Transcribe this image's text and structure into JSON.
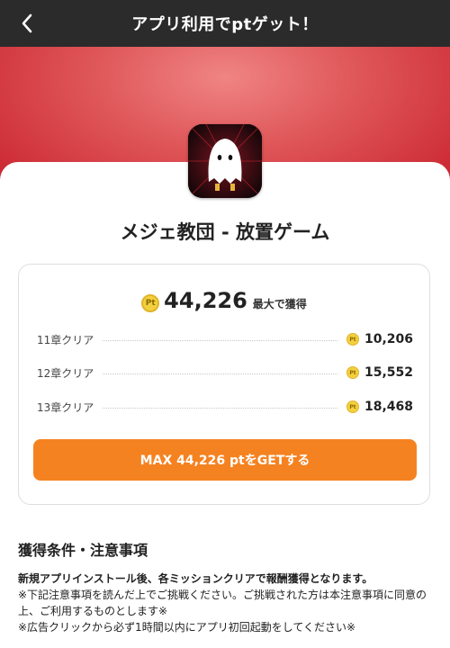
{
  "header": {
    "title": "アプリ利用でptゲット！"
  },
  "app": {
    "name": "メジェ教団 - 放置ゲーム"
  },
  "reward": {
    "coin_label": "Pt",
    "total": "44,226",
    "total_suffix": "最大で獲得",
    "missions": [
      {
        "label": "11章クリア",
        "points": "10,206"
      },
      {
        "label": "12章クリア",
        "points": "15,552"
      },
      {
        "label": "13章クリア",
        "points": "18,468"
      }
    ],
    "button_label": "MAX 44,226 ptをGETする"
  },
  "conditions": {
    "title": "獲得条件・注意事項",
    "lines": [
      "新規アプリインストール後、各ミッションクリアで報酬獲得となります。",
      "※下記注意事項を読んだ上でご挑戦ください。ご挑戦された方は本注意事項に同意の上、ご利用するものとします※",
      "※広告クリックから必ず1時間以内にアプリ初回起動をしてください※"
    ]
  },
  "colors": {
    "header_bg": "#2b2b2b",
    "banner_red": "#c81f2b",
    "button_orange": "#f58220",
    "coin_yellow": "#f4d03f"
  }
}
